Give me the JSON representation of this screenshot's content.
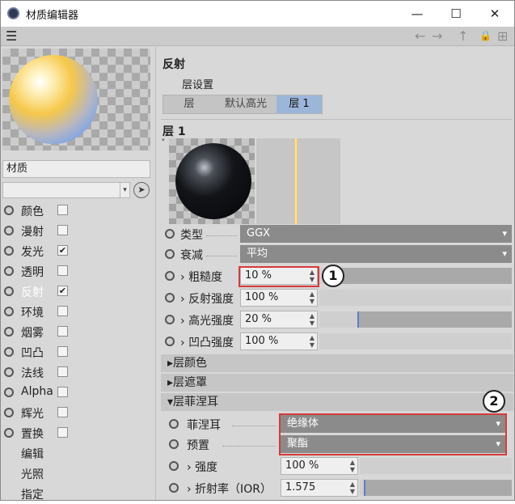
{
  "window": {
    "title": "材质编辑器",
    "controls": {
      "minimize": "—",
      "maximize": "☐",
      "close": "✕"
    }
  },
  "toolbar": {
    "menu_icon": "☰",
    "back_icon": "←",
    "forward_icon": "→",
    "up_icon": "↑",
    "lock_icon": "🔒",
    "new_icon": "⊞"
  },
  "left_panel": {
    "material_name": "材质",
    "channels": [
      {
        "label": "颜色",
        "checked": false
      },
      {
        "label": "漫射",
        "checked": false
      },
      {
        "label": "发光",
        "checked": true
      },
      {
        "label": "透明",
        "checked": false
      },
      {
        "label": "反射",
        "checked": true,
        "active": true
      },
      {
        "label": "环境",
        "checked": false
      },
      {
        "label": "烟雾",
        "checked": false
      },
      {
        "label": "凹凸",
        "checked": false
      },
      {
        "label": "法线",
        "checked": false
      },
      {
        "label": "Alpha",
        "checked": false
      },
      {
        "label": "辉光",
        "checked": false
      },
      {
        "label": "置换",
        "checked": false
      }
    ],
    "extra_items": [
      "编辑",
      "光照",
      "指定"
    ]
  },
  "right_panel": {
    "section_title": "反射",
    "layer_settings_label": "层设置",
    "tabs": [
      "层",
      "默认高光",
      "层 1"
    ],
    "selected_tab": 2,
    "layer_title": "层 1",
    "collapse_icon": "˅",
    "type": {
      "label": "类型",
      "value": "GGX"
    },
    "attenuation": {
      "label": "衰减",
      "value": "平均"
    },
    "roughness": {
      "label": "粗糙度",
      "value": "10 %",
      "fill": 0.1
    },
    "reflect_strength": {
      "label": "反射强度",
      "value": "100 %",
      "fill": 1.0
    },
    "specular_strength": {
      "label": "高光强度",
      "value": "20 %",
      "fill": 0.2
    },
    "bump_strength": {
      "label": "凹凸强度",
      "value": "100 %",
      "fill": 1.0
    },
    "groups": [
      "层颜色",
      "层遮罩",
      "层菲涅耳"
    ],
    "fresnel": {
      "label": "菲涅耳",
      "value": "绝缘体"
    },
    "preset": {
      "label": "预置",
      "value": "聚酯"
    },
    "strength": {
      "label": "强度",
      "value": "100 %",
      "fill": 1.0
    },
    "ior": {
      "label": "折射率（IOR）",
      "value": "1.575",
      "fill": 0.03
    }
  },
  "callouts": [
    "1",
    "2"
  ],
  "colors": {
    "highlight": "#d63a3a",
    "tab_selected": "#9cb6da",
    "combo_bg": "#8b8b8b"
  }
}
